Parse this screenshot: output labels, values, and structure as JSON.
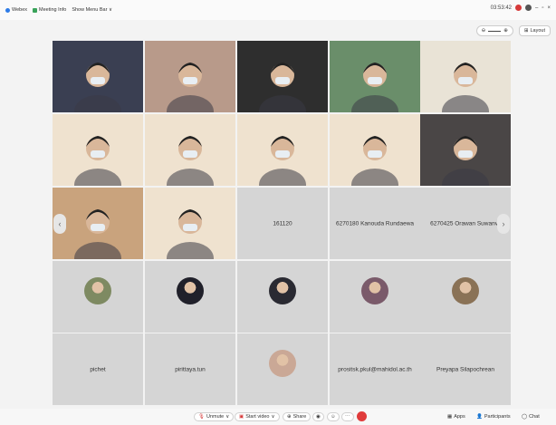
{
  "window": {
    "menu_items": [
      {
        "icon": "webex-icon",
        "label": "Webex"
      },
      {
        "icon": "meeting-icon",
        "label": "Meeting Info"
      },
      {
        "icon": "",
        "label": "Show Menu Bar ∨"
      }
    ],
    "timer": "03:53:42"
  },
  "view": {
    "zoom_minus": "⊖",
    "zoom_plus": "⊕",
    "layout_label": "Layout"
  },
  "participants": [
    {
      "name": "",
      "kind": "video",
      "color": "#3a3f52"
    },
    {
      "name": "",
      "kind": "video",
      "color": "#b89a8a"
    },
    {
      "name": "",
      "kind": "video",
      "color": "#2e2e2e"
    },
    {
      "name": "",
      "kind": "video",
      "color": "#6a8e6a"
    },
    {
      "name": "",
      "kind": "video",
      "color": "#e9e3d6"
    },
    {
      "name": "",
      "kind": "video",
      "color": "#efe2cf"
    },
    {
      "name": "",
      "kind": "video",
      "color": "#efe2cf"
    },
    {
      "name": "",
      "kind": "video",
      "color": "#efe2cf"
    },
    {
      "name": "",
      "kind": "video",
      "color": "#efe2cf"
    },
    {
      "name": "",
      "kind": "video",
      "color": "#4a4646"
    },
    {
      "name": "",
      "kind": "video",
      "color": "#c9a37d"
    },
    {
      "name": "",
      "kind": "video",
      "color": "#efe2cf"
    },
    {
      "name": "161120",
      "kind": "name"
    },
    {
      "name": "6270180 Kanouda Rundaewa",
      "kind": "name"
    },
    {
      "name": "6270425 Orawan Suwanvil",
      "kind": "name"
    },
    {
      "name": "",
      "kind": "photo",
      "color": "#7e8a62"
    },
    {
      "name": "",
      "kind": "photo",
      "color": "#20202a"
    },
    {
      "name": "",
      "kind": "photo",
      "color": "#2a2a32"
    },
    {
      "name": "",
      "kind": "photo",
      "color": "#7a5a6a"
    },
    {
      "name": "",
      "kind": "photo",
      "color": "#8a7256"
    },
    {
      "name": "pichet",
      "kind": "name"
    },
    {
      "name": "pirittaya.tun",
      "kind": "name"
    },
    {
      "name": "",
      "kind": "photo",
      "color": "#caa896"
    },
    {
      "name": "prositsk.pkul@mahidol.ac.th",
      "kind": "name"
    },
    {
      "name": "Preyapa Silapochrean",
      "kind": "name"
    }
  ],
  "toolbar": {
    "unmute": "Unmute",
    "start_video": "Start video",
    "share": "Share",
    "apps": "Apps",
    "participants": "Participants",
    "chat": "Chat"
  },
  "colors": {
    "accent_blue": "#2d7be8",
    "leave_red": "#e03b3b",
    "tile_grey": "#d5d5d5"
  }
}
